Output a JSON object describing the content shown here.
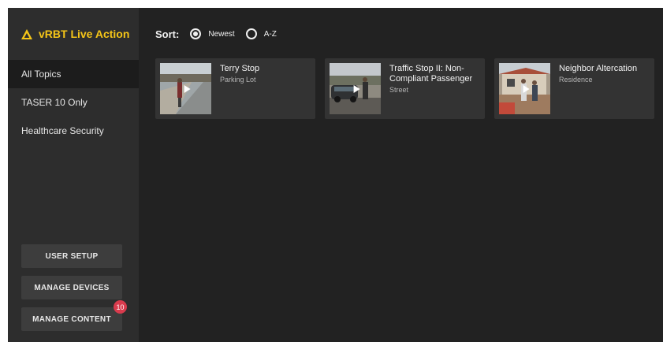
{
  "app": {
    "title": "vRBT Live Action",
    "accent_color": "#f5c518",
    "brand_icon": "warning-triangle-icon"
  },
  "sidebar": {
    "items": [
      {
        "label": "All Topics",
        "active": true
      },
      {
        "label": "TASER 10 Only",
        "active": false
      },
      {
        "label": "Healthcare Security",
        "active": false
      }
    ],
    "buttons": {
      "user_setup": "USER SETUP",
      "manage_devices": "MANAGE DEVICES",
      "manage_content": "MANAGE CONTENT",
      "manage_content_badge": "10",
      "badge_color": "#d83b4d"
    }
  },
  "sort": {
    "label": "Sort:",
    "options": [
      {
        "label": "Newest",
        "selected": true
      },
      {
        "label": "A-Z",
        "selected": false
      }
    ]
  },
  "cards": [
    {
      "title": "Terry Stop",
      "subtitle": "Parking Lot",
      "thumb_icon": "play-icon"
    },
    {
      "title": "Traffic Stop II: Non-Compliant Passenger",
      "subtitle": "Street",
      "thumb_icon": "play-icon"
    },
    {
      "title": "Neighbor Altercation",
      "subtitle": "Residence",
      "thumb_icon": "play-icon"
    }
  ]
}
